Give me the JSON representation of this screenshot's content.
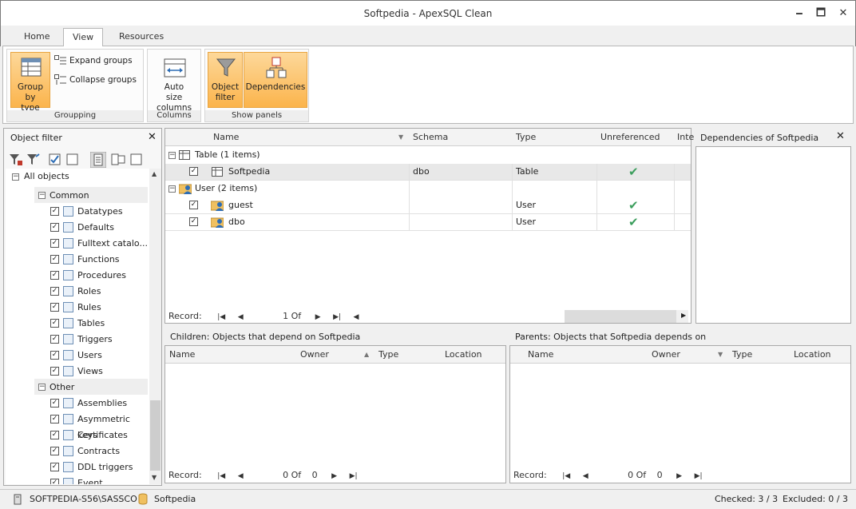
{
  "window": {
    "title": "Softpedia - ApexSQL Clean",
    "minimize": "🗕",
    "maximize": "🗖",
    "close": "✕"
  },
  "tabs": [
    "Home",
    "View",
    "Resources"
  ],
  "ribbon": {
    "grouping": {
      "label": "Groupping",
      "group_by_type": "Group by type",
      "expand": "Expand groups",
      "collapse": "Collapse groups"
    },
    "columns": {
      "label": "Columns",
      "auto_size": "Auto size columns"
    },
    "show_panels": {
      "label": "Show panels",
      "object_filter": "Object filter",
      "dependencies": "Dependencies"
    }
  },
  "object_filter": {
    "title": "Object filter",
    "root": "All objects",
    "common": {
      "label": "Common",
      "items": [
        "Datatypes",
        "Defaults",
        "Fulltext catalo...",
        "Functions",
        "Procedures",
        "Roles",
        "Rules",
        "Tables",
        "Triggers",
        "Users",
        "Views"
      ]
    },
    "other": {
      "label": "Other",
      "items": [
        "Assemblies",
        "Asymmetric keys",
        "Certificates",
        "Contracts",
        "DDL triggers",
        "Event notificat..."
      ]
    }
  },
  "grid": {
    "columns": [
      "Name",
      "Schema",
      "Type",
      "Unreferenced",
      "Inte"
    ],
    "groups": [
      {
        "label": "Table (1 items)",
        "rows": [
          {
            "name": "Softpedia",
            "schema": "dbo",
            "type": "Table"
          }
        ]
      },
      {
        "label": "User (2 items)",
        "rows": [
          {
            "name": "guest",
            "schema": "",
            "type": "User"
          },
          {
            "name": "dbo",
            "schema": "",
            "type": "User"
          }
        ]
      }
    ],
    "record_label": "Record:",
    "page": "1",
    "of": "Of"
  },
  "dependencies": {
    "title": "Dependencies of Softpedia"
  },
  "children": {
    "title": "Children: Objects that depend on Softpedia",
    "columns": [
      "Name",
      "Owner",
      "Type",
      "Location"
    ],
    "record_label": "Record:",
    "page": "0",
    "of": "Of",
    "total": "0"
  },
  "parents": {
    "title": "Parents: Objects that Softpedia depends on",
    "columns": [
      "Name",
      "Owner",
      "Type",
      "Location"
    ],
    "record_label": "Record:",
    "page": "0",
    "of": "Of",
    "total": "0"
  },
  "status": {
    "server": "SOFTPEDIA-S56\\SASSCO",
    "database": "Softpedia",
    "checked": "Checked: 3 / 3",
    "excluded": "Excluded: 0 / 3"
  },
  "colors": {
    "accent": "#fbb44c",
    "tick": "#3c9e5d",
    "selected_row": "#e8e8e8"
  }
}
